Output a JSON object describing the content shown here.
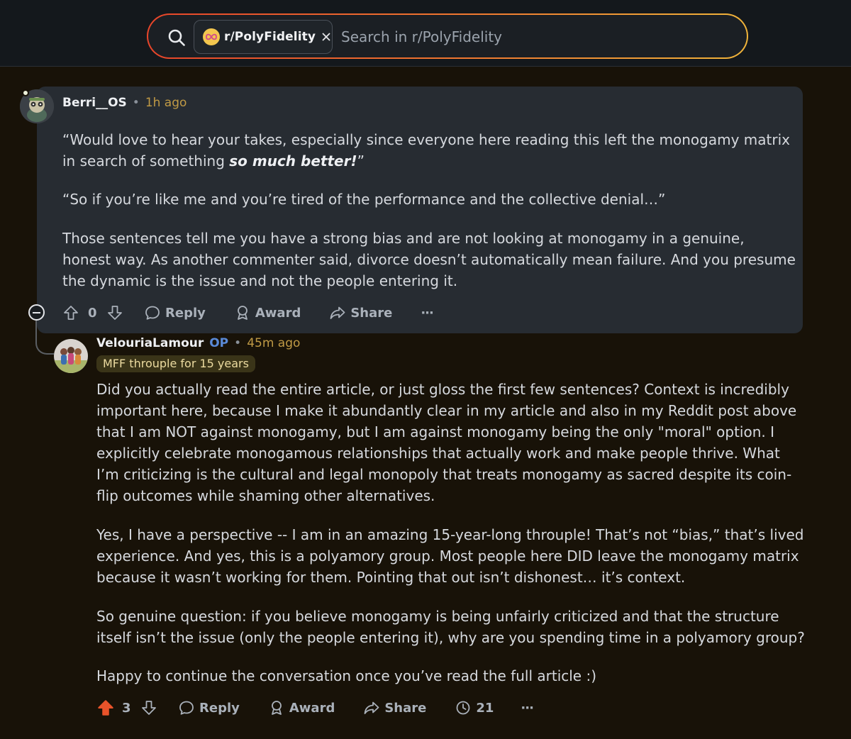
{
  "search": {
    "subreddit": "r/PolyFidelity",
    "placeholder": "Search in r/PolyFidelity"
  },
  "comments": [
    {
      "author": "Berri__OS",
      "separator": "•",
      "time": "1h ago",
      "para1_pre": "“Would love to hear your takes, especially since everyone here reading this left the monogamy matrix in search of something ",
      "para1_emph": "so much better!",
      "para1_post": "”",
      "para2": "“So if you’re like me and you’re tired of the performance and the collective denial…”",
      "para3": "Those sentences tell me you have a strong bias and are not looking at monogamy in a genuine, honest way. As another commenter said, divorce doesn’t automatically mean failure. And you presume the dynamic is the issue and not the people entering it.",
      "votes": "0",
      "actions": {
        "reply": "Reply",
        "award": "Award",
        "share": "Share",
        "more": "···"
      }
    },
    {
      "author": "VelouriaLamour",
      "op_badge": "OP",
      "separator": "•",
      "time": "45m ago",
      "flair": "MFF throuple for 15 years",
      "paragraphs": [
        "Did you actually read the entire article, or just gloss the first few sentences? Context is incredibly important here, because I make it abundantly clear in my article and also in my Reddit post above that I am NOT against monogamy, but I am against monogamy being the only \"moral\" option. I explicitly celebrate monogamous relationships that actually work and make people thrive. What I’m criticizing is the cultural and legal monopoly that treats monogamy as sacred despite its coin-flip outcomes while shaming other alternatives.",
        "Yes, I have a perspective -- I am in an amazing 15-year-long throuple! That’s not “bias,” that’s lived experience. And yes, this is a polyamory group. Most people here DID leave the monogamy matrix because it wasn’t working for them. Pointing that out isn’t dishonest… it’s context.",
        "So genuine question: if you believe monogamy is being unfairly criticized and that the structure itself isn’t the issue (only the people entering it), why are you spending time in a polyamory group?",
        "Happy to continue the conversation once you’ve read the full article :)"
      ],
      "votes": "3",
      "actions": {
        "reply": "Reply",
        "award": "Award",
        "share": "Share",
        "awards_count": "21",
        "more": "···"
      }
    }
  ],
  "colors": {
    "upvote_active": "#e8532a",
    "time": "#c09a45",
    "op": "#5a8ad8",
    "flair_bg": "#3a3418"
  },
  "icons": [
    "search-icon",
    "subreddit-icon",
    "close-icon",
    "upvote-icon",
    "downvote-icon",
    "reply-icon",
    "award-icon",
    "share-icon",
    "awards-count-icon",
    "more-icon",
    "collapse-icon"
  ]
}
